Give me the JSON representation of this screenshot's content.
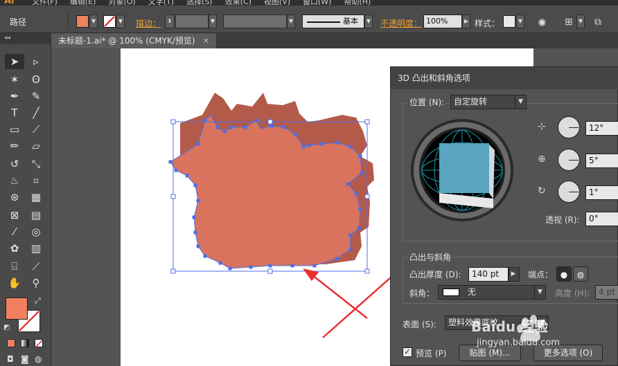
{
  "app": {
    "logo": "Ai",
    "menus": [
      "文件(F)",
      "编辑(E)",
      "对象(O)",
      "文字(T)",
      "选择(S)",
      "效果(C)",
      "视图(V)",
      "窗口(W)",
      "帮助(H)"
    ]
  },
  "controlbar": {
    "selection_label": "路径",
    "fill_color": "#f08060",
    "stroke_label": "描边：",
    "brush_label": "基本",
    "opacity_label": "不透明度：",
    "opacity_value": "100%",
    "style_label": "样式："
  },
  "document": {
    "tab_title": "未标题-1.ai* @ 100% (CMYK/预览)",
    "tab_close": "×",
    "shape_color": "#d9735e",
    "shape_dark": "#b35a4a"
  },
  "toolbox": {
    "grip": "◂◂",
    "tools": [
      "selection-tool",
      "direct-selection-tool",
      "magic-wand-tool",
      "lasso-tool",
      "pen-tool",
      "add-anchor-tool",
      "type-tool",
      "line-tool",
      "rectangle-tool",
      "paintbrush-tool",
      "pencil-tool",
      "eraser-tool",
      "rotate-tool",
      "scale-tool",
      "warp-tool",
      "free-transform-tool",
      "shape-builder-tool",
      "perspective-grid-tool",
      "mesh-tool",
      "gradient-tool",
      "eyedropper-tool",
      "blend-tool",
      "symbol-sprayer-tool",
      "column-graph-tool",
      "artboard-tool",
      "slice-tool",
      "hand-tool",
      "zoom-tool"
    ],
    "fill_color": "#f08060"
  },
  "dialog": {
    "title": "3D 凸出和斜角选项",
    "position_label": "位置 (N):",
    "position_value": "自定旋转",
    "rotate_x": "12°",
    "rotate_y": "5°",
    "rotate_z": "1°",
    "perspective_label": "透视 (R):",
    "perspective_value": "0°",
    "extrude_section": "凸出与斜角",
    "extrude_depth_label": "凸出厚度 (D):",
    "extrude_depth_value": "140 pt",
    "cap_label": "端点：",
    "bevel_label": "斜角：",
    "bevel_value": "无",
    "height_label": "高度 (H):",
    "height_value": "4 pt",
    "surface_label": "表面 (S):",
    "surface_value": "塑料效果底纹",
    "preview_label": "预览 (P)",
    "map_button": "贴图 (M)...",
    "more_options_button": "更多选项 (O)",
    "cube_color": "#5aa6c0"
  },
  "watermark": {
    "brand": "Baidu 经验",
    "url": "jingyan.baidu.com"
  }
}
